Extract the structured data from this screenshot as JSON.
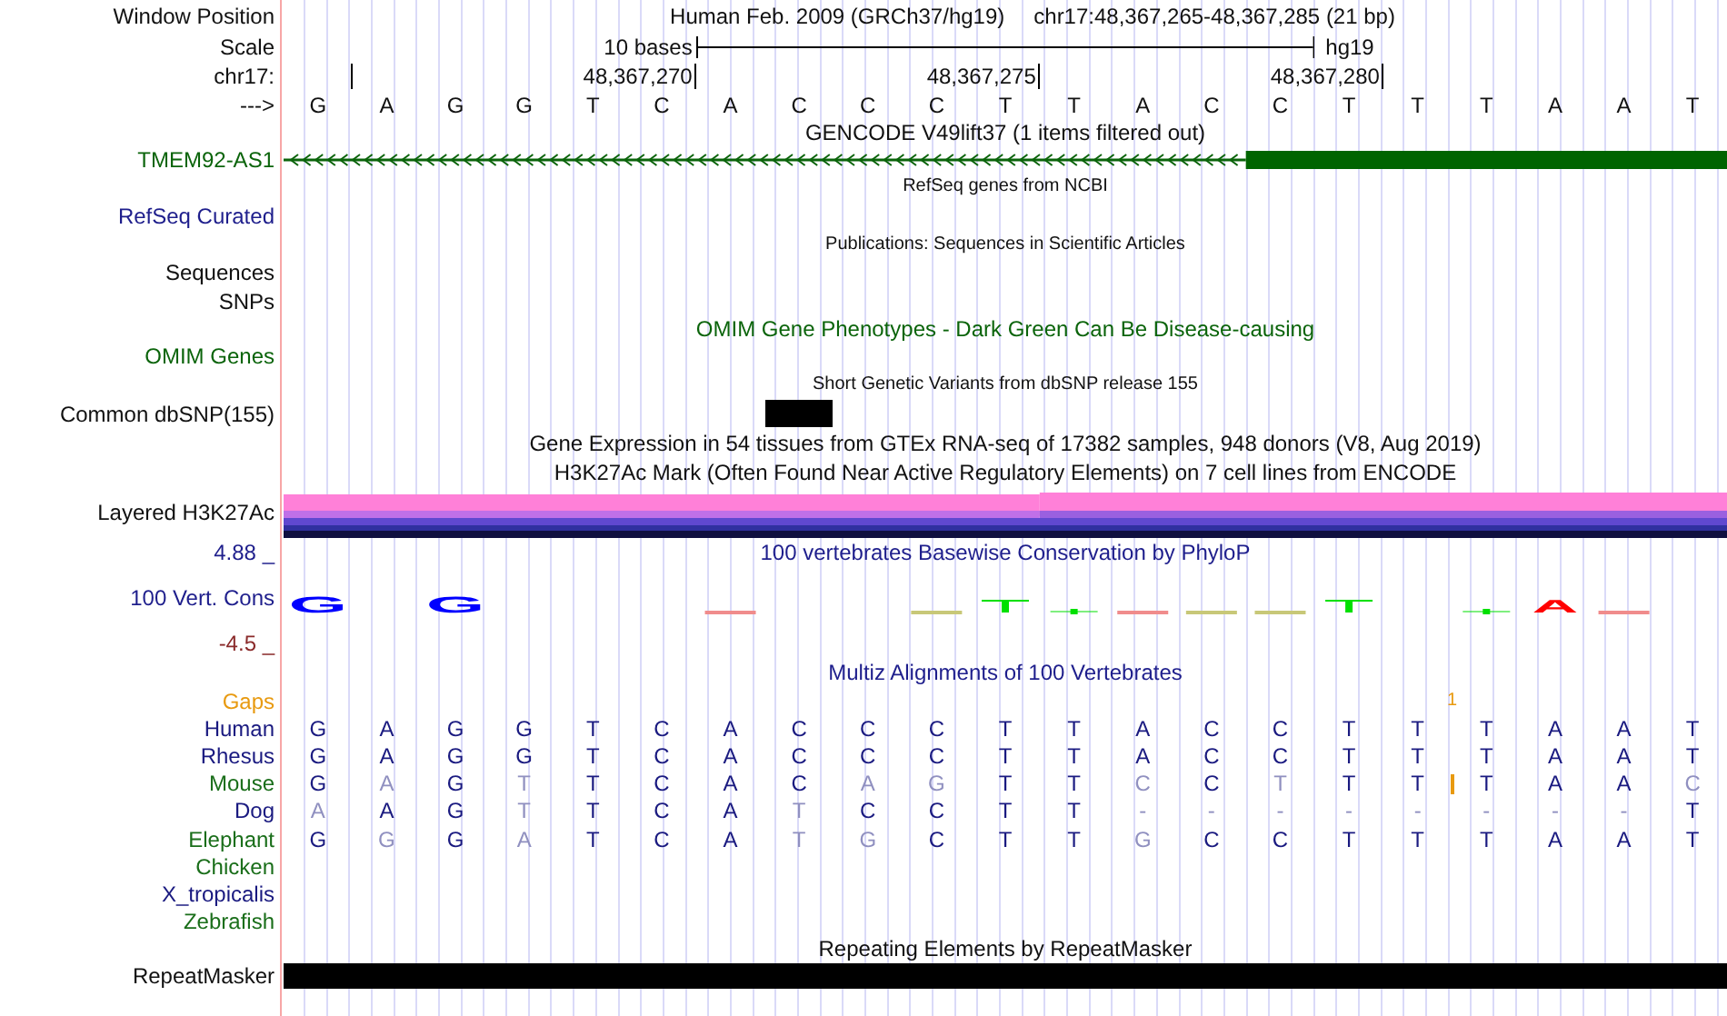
{
  "position": {
    "label": "Window Position",
    "assembly": "Human Feb. 2009 (GRCh37/hg19)",
    "range": "chr17:48,367,265-48,367,285 (21 bp)"
  },
  "scale": {
    "label": "Scale",
    "span": "10 bases",
    "assembly": "hg19"
  },
  "ruler": {
    "label": "chr17:",
    "ticks": [
      "48,367,270",
      "48,367,275",
      "48,367,280"
    ]
  },
  "sequence": {
    "label": "--->",
    "bases": [
      "G",
      "A",
      "G",
      "G",
      "T",
      "C",
      "A",
      "C",
      "C",
      "C",
      "T",
      "T",
      "A",
      "C",
      "C",
      "T",
      "T",
      "T",
      "A",
      "A",
      "T"
    ]
  },
  "gencode": {
    "title": "GENCODE V49lift37 (1 items filtered out)",
    "gene": "TMEM92-AS1"
  },
  "refseq": {
    "title": "RefSeq genes from NCBI",
    "label": "RefSeq Curated"
  },
  "publications": {
    "title": "Publications: Sequences in Scientific Articles",
    "labels": [
      "Sequences",
      "SNPs"
    ]
  },
  "omim": {
    "title": "OMIM Gene Phenotypes - Dark Green Can Be Disease-causing",
    "label": "OMIM Genes"
  },
  "dbsnp": {
    "title": "Short Genetic Variants from dbSNP release 155",
    "label": "Common dbSNP(155)"
  },
  "gtex": {
    "title": "Gene Expression in 54 tissues from GTEx RNA-seq of 17382 samples, 948 donors (V8, Aug 2019)"
  },
  "h3k27ac": {
    "title": "H3K27Ac Mark (Often Found Near Active Regulatory Elements) on 7 cell lines from ENCODE",
    "label": "Layered H3K27Ac"
  },
  "phylop": {
    "title": "100 vertebrates Basewise Conservation by PhyloP",
    "label": "100 Vert. Cons",
    "max_label": "4.88 _",
    "min_label": "-4.5 _",
    "columns": [
      {
        "kind": "letter",
        "text": "G",
        "color": "#0000ff"
      },
      {
        "kind": "none"
      },
      {
        "kind": "letter",
        "text": "G",
        "color": "#0000ff"
      },
      {
        "kind": "none"
      },
      {
        "kind": "none"
      },
      {
        "kind": "none"
      },
      {
        "kind": "line",
        "color": "#f08c8c"
      },
      {
        "kind": "none"
      },
      {
        "kind": "none"
      },
      {
        "kind": "line",
        "color": "#c8c878"
      },
      {
        "kind": "tbar",
        "color": "#00e000"
      },
      {
        "kind": "dot",
        "color": "#00e000"
      },
      {
        "kind": "line",
        "color": "#f08c8c"
      },
      {
        "kind": "line",
        "color": "#c8c878"
      },
      {
        "kind": "line",
        "color": "#c8c878"
      },
      {
        "kind": "tbar",
        "color": "#00e000"
      },
      {
        "kind": "none"
      },
      {
        "kind": "dot",
        "color": "#00e000"
      },
      {
        "kind": "letter",
        "text": "A",
        "color": "#ff0000"
      },
      {
        "kind": "line",
        "color": "#f08c8c"
      },
      {
        "kind": "none"
      }
    ]
  },
  "multiz": {
    "title": "Multiz Alignments of 100 Vertebrates",
    "gaps_label": "Gaps",
    "gap_count": "1",
    "species": [
      {
        "name": "Human",
        "color": "#1a1a80",
        "insertion_mark": false,
        "bases": [
          {
            "base": "G",
            "differs": false
          },
          {
            "base": "A",
            "differs": false
          },
          {
            "base": "G",
            "differs": false
          },
          {
            "base": "G",
            "differs": false
          },
          {
            "base": "T",
            "differs": false
          },
          {
            "base": "C",
            "differs": false
          },
          {
            "base": "A",
            "differs": false
          },
          {
            "base": "C",
            "differs": false
          },
          {
            "base": "C",
            "differs": false
          },
          {
            "base": "C",
            "differs": false
          },
          {
            "base": "T",
            "differs": false
          },
          {
            "base": "T",
            "differs": false
          },
          {
            "base": "A",
            "differs": false
          },
          {
            "base": "C",
            "differs": false
          },
          {
            "base": "C",
            "differs": false
          },
          {
            "base": "T",
            "differs": false
          },
          {
            "base": "T",
            "differs": false
          },
          {
            "base": "T",
            "differs": false
          },
          {
            "base": "A",
            "differs": false
          },
          {
            "base": "A",
            "differs": false
          },
          {
            "base": "T",
            "differs": false
          }
        ]
      },
      {
        "name": "Rhesus",
        "color": "#1a1a80",
        "insertion_mark": false,
        "bases": [
          {
            "base": "G",
            "differs": false
          },
          {
            "base": "A",
            "differs": false
          },
          {
            "base": "G",
            "differs": false
          },
          {
            "base": "G",
            "differs": false
          },
          {
            "base": "T",
            "differs": false
          },
          {
            "base": "C",
            "differs": false
          },
          {
            "base": "A",
            "differs": false
          },
          {
            "base": "C",
            "differs": false
          },
          {
            "base": "C",
            "differs": false
          },
          {
            "base": "C",
            "differs": false
          },
          {
            "base": "T",
            "differs": false
          },
          {
            "base": "T",
            "differs": false
          },
          {
            "base": "A",
            "differs": false
          },
          {
            "base": "C",
            "differs": false
          },
          {
            "base": "C",
            "differs": false
          },
          {
            "base": "T",
            "differs": false
          },
          {
            "base": "T",
            "differs": false
          },
          {
            "base": "T",
            "differs": false
          },
          {
            "base": "A",
            "differs": false
          },
          {
            "base": "A",
            "differs": false
          },
          {
            "base": "T",
            "differs": false
          }
        ]
      },
      {
        "name": "Mouse",
        "color": "#1a6e1a",
        "insertion_mark": true,
        "bases": [
          {
            "base": "G",
            "differs": false
          },
          {
            "base": "A",
            "differs": true
          },
          {
            "base": "G",
            "differs": false
          },
          {
            "base": "T",
            "differs": true
          },
          {
            "base": "T",
            "differs": false
          },
          {
            "base": "C",
            "differs": false
          },
          {
            "base": "A",
            "differs": false
          },
          {
            "base": "C",
            "differs": false
          },
          {
            "base": "A",
            "differs": true
          },
          {
            "base": "G",
            "differs": true
          },
          {
            "base": "T",
            "differs": false
          },
          {
            "base": "T",
            "differs": false
          },
          {
            "base": "C",
            "differs": true
          },
          {
            "base": "C",
            "differs": false
          },
          {
            "base": "T",
            "differs": true
          },
          {
            "base": "T",
            "differs": false
          },
          {
            "base": "T",
            "differs": false
          },
          {
            "base": "T",
            "differs": false
          },
          {
            "base": "A",
            "differs": false
          },
          {
            "base": "A",
            "differs": false
          },
          {
            "base": "C",
            "differs": true
          }
        ]
      },
      {
        "name": "Dog",
        "color": "#1a1a80",
        "insertion_mark": false,
        "bases": [
          {
            "base": "A",
            "differs": true
          },
          {
            "base": "A",
            "differs": false
          },
          {
            "base": "G",
            "differs": false
          },
          {
            "base": "T",
            "differs": true
          },
          {
            "base": "T",
            "differs": false
          },
          {
            "base": "C",
            "differs": false
          },
          {
            "base": "A",
            "differs": false
          },
          {
            "base": "T",
            "differs": true
          },
          {
            "base": "C",
            "differs": false
          },
          {
            "base": "C",
            "differs": false
          },
          {
            "base": "T",
            "differs": false
          },
          {
            "base": "T",
            "differs": false
          },
          {
            "base": "-",
            "differs": true
          },
          {
            "base": "-",
            "differs": true
          },
          {
            "base": "-",
            "differs": true
          },
          {
            "base": "-",
            "differs": true
          },
          {
            "base": "-",
            "differs": true
          },
          {
            "base": "-",
            "differs": true
          },
          {
            "base": "-",
            "differs": true
          },
          {
            "base": "-",
            "differs": true
          },
          {
            "base": "T",
            "differs": false
          }
        ]
      },
      {
        "name": "Elephant",
        "color": "#1a6e1a",
        "insertion_mark": false,
        "bases": [
          {
            "base": "G",
            "differs": false
          },
          {
            "base": "G",
            "differs": true
          },
          {
            "base": "G",
            "differs": false
          },
          {
            "base": "A",
            "differs": true
          },
          {
            "base": "T",
            "differs": false
          },
          {
            "base": "C",
            "differs": false
          },
          {
            "base": "A",
            "differs": false
          },
          {
            "base": "T",
            "differs": true
          },
          {
            "base": "G",
            "differs": true
          },
          {
            "base": "C",
            "differs": false
          },
          {
            "base": "T",
            "differs": false
          },
          {
            "base": "T",
            "differs": false
          },
          {
            "base": "G",
            "differs": true
          },
          {
            "base": "C",
            "differs": false
          },
          {
            "base": "C",
            "differs": false
          },
          {
            "base": "T",
            "differs": false
          },
          {
            "base": "T",
            "differs": false
          },
          {
            "base": "T",
            "differs": false
          },
          {
            "base": "A",
            "differs": false
          },
          {
            "base": "A",
            "differs": false
          },
          {
            "base": "T",
            "differs": false
          }
        ]
      },
      {
        "name": "Chicken",
        "color": "#1a6e1a",
        "insertion_mark": false
      },
      {
        "name": "X_tropicalis",
        "color": "#1a1a80",
        "insertion_mark": false
      },
      {
        "name": "Zebrafish",
        "color": "#1a6e1a",
        "insertion_mark": false
      }
    ]
  },
  "repeatmasker": {
    "title": "Repeating Elements by RepeatMasker",
    "label": "RepeatMasker"
  }
}
